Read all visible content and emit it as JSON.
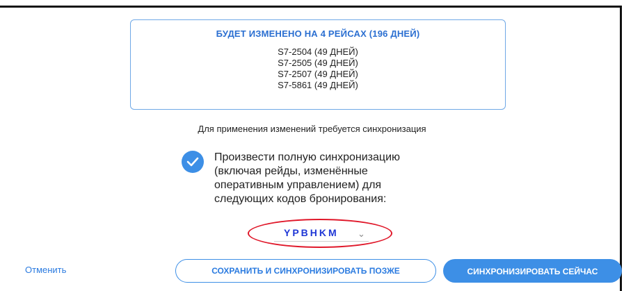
{
  "info": {
    "title": "БУДЕТ ИЗМЕНЕНО НА 4 РЕЙСАХ (196 ДНЕЙ)",
    "flights": [
      "S7-2504 (49 ДНЕЙ)",
      "S7-2505 (49 ДНЕЙ)",
      "S7-2507 (49 ДНЕЙ)",
      "S7-5861 (49 ДНЕЙ)"
    ]
  },
  "sync_required": "Для применения изменений требуется синхронизация",
  "full_sync": {
    "checked": true,
    "lines": [
      "Произвести полную синхронизацию",
      "(включая рейды, изменённые",
      "оперативным управлением) для",
      "следующих кодов бронирования:"
    ]
  },
  "booking_codes": {
    "value": "YPBHKM",
    "icon": "chevron-down-icon"
  },
  "actions": {
    "cancel_label": "Отменить",
    "save_later_label": "СОХРАНИТЬ И СИНХРОНИЗИРОВАТЬ ПОЗЖЕ",
    "sync_now_label": "СИНХРОНИЗИРОВАТЬ СЕЙЧАС"
  },
  "colors": {
    "accent": "#3d8fe6",
    "title_blue": "#2b6fd1",
    "code_blue": "#1f37d6",
    "highlight_red": "#e0182a"
  }
}
